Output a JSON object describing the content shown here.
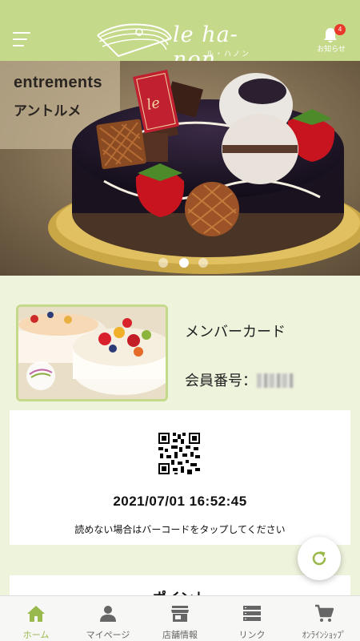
{
  "header": {
    "logo_text": "le ha-non",
    "logo_sub": "ル・ハノン",
    "notice_label": "お知らせ",
    "notice_count": "4",
    "bg_color": "#c5d98a"
  },
  "hero": {
    "title": "entrements",
    "subtitle": "アントルメ",
    "slide_count": 3,
    "active_slide": 2
  },
  "member": {
    "title": "メンバーカード",
    "number_label": "会員番号："
  },
  "barcode": {
    "timestamp": "2021/07/01 16:52:45",
    "hint": "読めない場合はバーコードをタップしてください"
  },
  "points": {
    "title": "ポイント"
  },
  "tabbar": {
    "accent": "#9ab94c",
    "items": [
      {
        "label": "ホーム",
        "icon": "home-icon",
        "active": true
      },
      {
        "label": "マイページ",
        "icon": "person-icon",
        "active": false
      },
      {
        "label": "店舗情報",
        "icon": "store-icon",
        "active": false
      },
      {
        "label": "リンク",
        "icon": "list-icon",
        "active": false
      },
      {
        "label": "ｵﾝﾗｲﾝｼｮｯﾌﾟ",
        "icon": "cart-icon",
        "active": false
      }
    ]
  }
}
